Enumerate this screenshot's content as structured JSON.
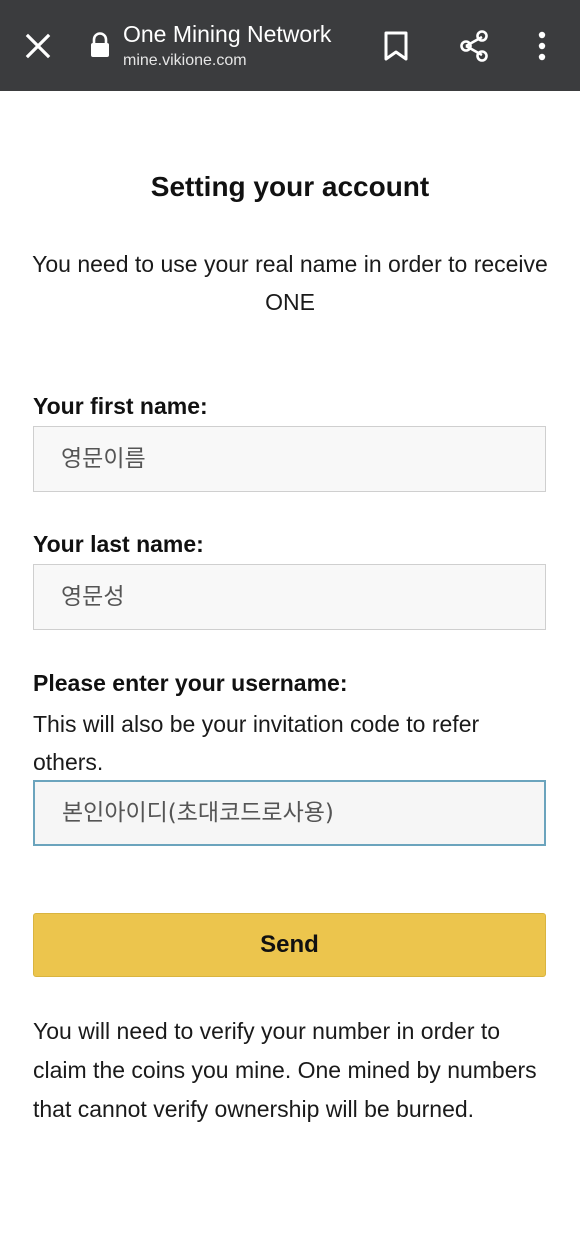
{
  "browser": {
    "title": "One Mining Network",
    "url": "mine.vikione.com"
  },
  "form": {
    "heading": "Setting your account",
    "intro": "You need to use your real name in order to receive ONE",
    "first_name_label": "Your first name:",
    "first_name_placeholder": "영문이름",
    "last_name_label": "Your last name:",
    "last_name_placeholder": "영문성",
    "username_label": "Please enter your username:",
    "username_help": "This will also be your invitation code to refer others.",
    "username_placeholder": "본인아이디(초대코드로사용)",
    "send_label": "Send",
    "note": "You will need to verify your number in order to claim the coins you mine. One mined by numbers that cannot verify ownership will be burned."
  },
  "icons": {
    "close": "close-icon",
    "lock": "lock-icon",
    "bookmark": "bookmark-icon",
    "share": "share-icon",
    "more": "more-vertical-icon"
  },
  "colors": {
    "toolbar": "#3b3c3e",
    "send_button": "#ecc54d",
    "focus_border": "#6ba4bd"
  }
}
